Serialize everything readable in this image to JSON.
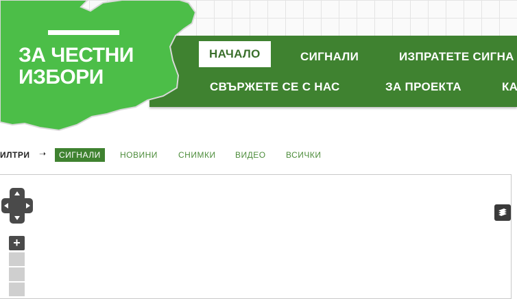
{
  "logo": {
    "line1": "ЗА ЧЕСТНИ",
    "line2": "ИЗБОРИ",
    "brand_green": "#4cbe48",
    "icon": "bulgaria-map-logo"
  },
  "nav": {
    "color": "#3f8230",
    "row1": [
      {
        "label": "НАЧАЛО",
        "active": true
      },
      {
        "label": "СИГНАЛИ",
        "active": false
      },
      {
        "label": "ИЗПРАТЕТЕ СИГНА",
        "active": false
      }
    ],
    "row2": [
      {
        "label": "СВЪРЖЕТЕ СЕ С НАС"
      },
      {
        "label": "ЗА ПРОЕКТА"
      },
      {
        "label": "КА"
      }
    ]
  },
  "filters": {
    "label": "ИЛТРИ",
    "arrow": "➝",
    "items": [
      {
        "label": "СИГНАЛИ",
        "active": true
      },
      {
        "label": "НОВИНИ",
        "active": false
      },
      {
        "label": "СНИМКИ",
        "active": false
      },
      {
        "label": "ВИДЕО",
        "active": false
      },
      {
        "label": "ВСИЧКИ",
        "active": false
      }
    ]
  },
  "map_controls": {
    "zoom_in": "+",
    "pan_icon": "pan-arrows-icon",
    "layers_icon": "layers-icon"
  }
}
